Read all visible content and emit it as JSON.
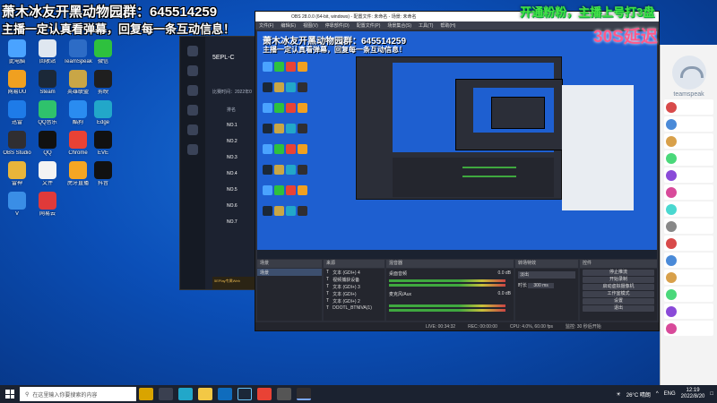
{
  "overlay": {
    "top_line_name": "萧木冰友开黑动物园群：",
    "top_line_number": "645514259",
    "second_line": "主播一定认真看弹幕，回复每一条互动信息！",
    "promo": "开通粉粉，主播上号打3盘",
    "delay": "30S延迟"
  },
  "desktop_icons": [
    {
      "label": "此电脑",
      "color": "#4aa3ff"
    },
    {
      "label": "回收站",
      "color": "#dfe7f0"
    },
    {
      "label": "TeamSpeak",
      "color": "#2d6cc6"
    },
    {
      "label": "微信",
      "color": "#2ec13e"
    },
    {
      "label": "网易UU",
      "color": "#f0a020"
    },
    {
      "label": "Steam",
      "color": "#1b2838"
    },
    {
      "label": "英雄联盟",
      "color": "#c9a646"
    },
    {
      "label": "剪映",
      "color": "#1f1f1f"
    },
    {
      "label": "迅雷",
      "color": "#1e7be8"
    },
    {
      "label": "QQ音乐",
      "color": "#2fc26c"
    },
    {
      "label": "酷狗",
      "color": "#2a8cf0"
    },
    {
      "label": "Edge",
      "color": "#22a7c9"
    },
    {
      "label": "OBS Studio",
      "color": "#302e31"
    },
    {
      "label": "QQ",
      "color": "#111"
    },
    {
      "label": "Chrome",
      "color": "#e94235"
    },
    {
      "label": "EVE",
      "color": "#111"
    },
    {
      "label": "雷神",
      "color": "#e9b53a"
    },
    {
      "label": "文件",
      "color": "#f3f3f3"
    },
    {
      "label": "虎牙直播",
      "color": "#f5a623"
    },
    {
      "label": "抖音",
      "color": "#111"
    },
    {
      "label": "V",
      "color": "#3a8ee6"
    },
    {
      "label": "网易云",
      "color": "#e03a3a"
    }
  ],
  "backwin": {
    "title": "5EPL-C",
    "date": "比赛时间：2022年0",
    "header": "排名",
    "rows": [
      "NO.1",
      "NO.2",
      "NO.3",
      "NO.4",
      "NO.5",
      "NO.6",
      "NO.7"
    ],
    "gold": "5EPlay专属Web",
    "footer": "观看入场须知"
  },
  "obs": {
    "title": "OBS 28.0.0 (64-bit, windows) - 配置文件: 未命名 - 场景: 未命名",
    "menu": [
      "文件(F)",
      "编辑(E)",
      "视图(V)",
      "停靠部件(D)",
      "配置文件(P)",
      "场景集合(S)",
      "工具(T)",
      "帮助(H)"
    ],
    "docks": {
      "scenes": "场景",
      "sources": "来源",
      "mixer": "混音器",
      "transitions": "转场特效",
      "controls": "控件"
    },
    "scene_item": "场景",
    "sources": [
      "文本 (GDI+) 4",
      "视频捕获设备",
      "文本 (GDI+) 3",
      "文本 (GDI+)",
      "文本 (GDI+) 2",
      "DOOTL_BTNIVA(1)"
    ],
    "mixer": [
      {
        "name": "桌面音频",
        "db": "0.0 dB"
      },
      {
        "name": "麦克风/Aux",
        "db": "0.0 dB"
      }
    ],
    "transition": {
      "name": "淡出",
      "duration_label": "时长",
      "duration": "300 ms"
    },
    "controls": [
      "停止推流",
      "开始录制",
      "启动虚拟摄像机",
      "工作室模式",
      "设置",
      "退出"
    ],
    "status": {
      "live": "LIVE: 00:34:32",
      "rec": "REC: 00:00:00",
      "cpu": "CPU: 4.0%, 60.00 fps",
      "mode": "监控: 30 秒后开始"
    }
  },
  "taskbar": {
    "search_placeholder": "在这里输入你要搜索的内容",
    "weather": "26°C 晴朗",
    "lang": "ENG",
    "time": "12:19",
    "date": "2022/8/20"
  },
  "right_panel": {
    "name": "teamspeak"
  }
}
